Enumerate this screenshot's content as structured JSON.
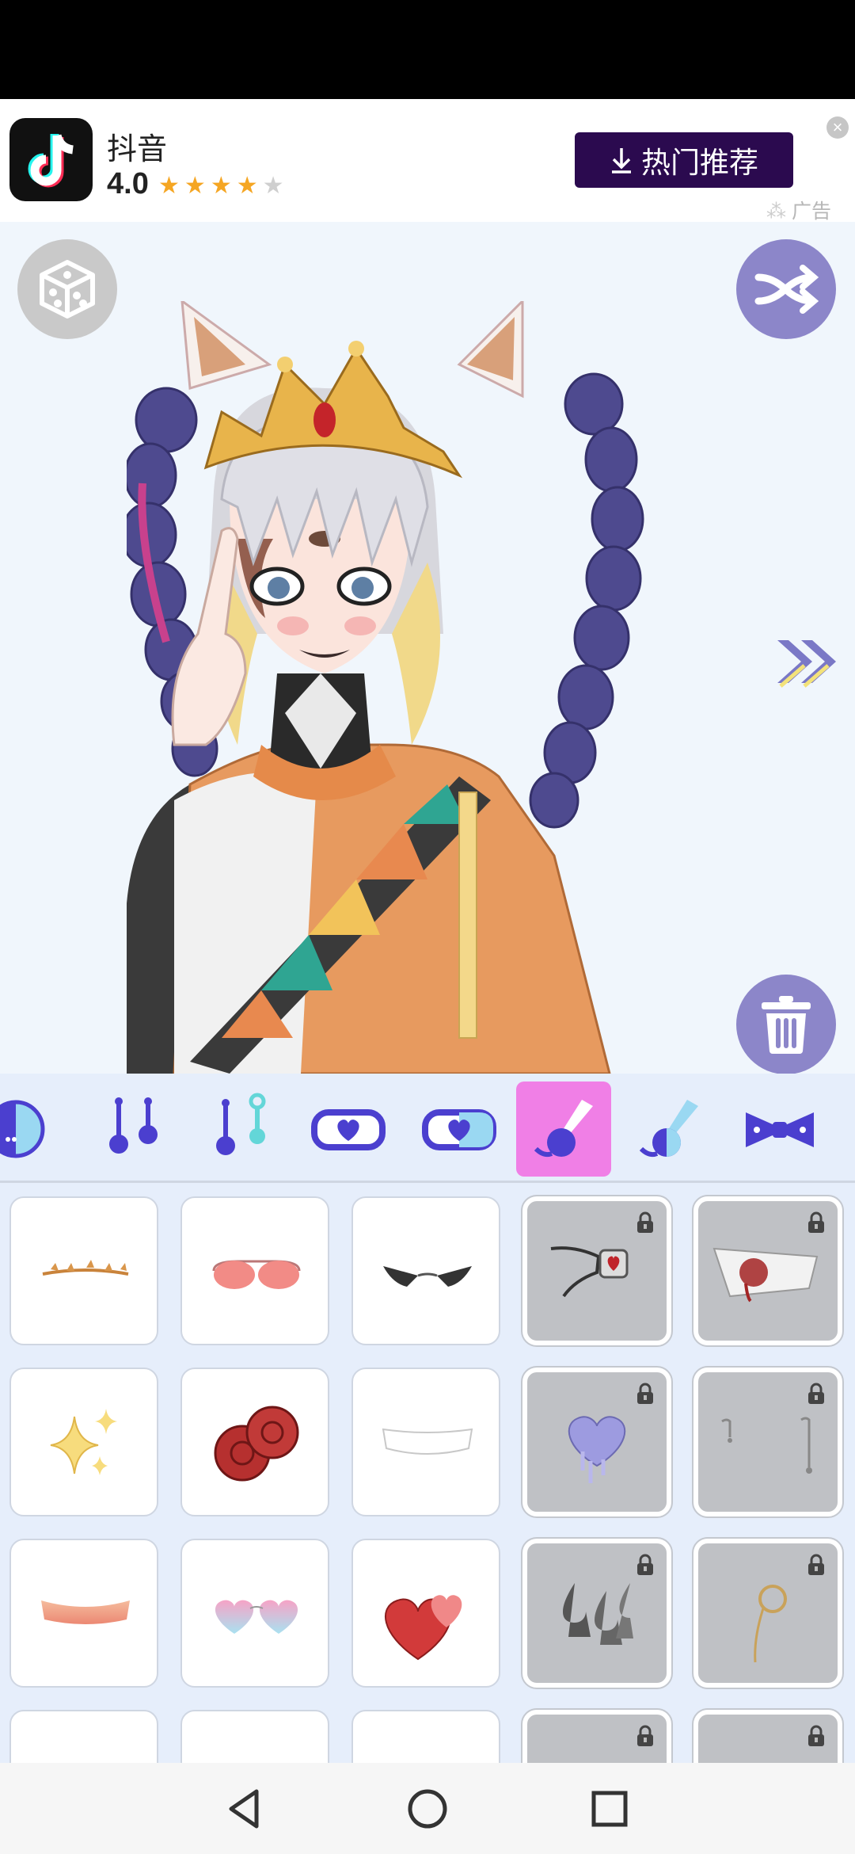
{
  "ad": {
    "app_name": "抖音",
    "rating": "4.0",
    "stars_filled": 4,
    "stars_total": 5,
    "button_label": "热门推荐",
    "ad_label": "广告",
    "close_icon": "close-icon",
    "download_icon": "download-icon"
  },
  "stage": {
    "dice_icon": "dice-icon",
    "shuffle_icon": "shuffle-icon",
    "trash_icon": "trash-icon",
    "next_icon": "double-chevron-right-icon"
  },
  "tabs": [
    {
      "icon": "skin-tone-icon",
      "active": false
    },
    {
      "icon": "earring-pair-icon",
      "active": false
    },
    {
      "icon": "earring-mixed-icon",
      "active": false
    },
    {
      "icon": "heart-mask-icon",
      "active": false
    },
    {
      "icon": "heart-mask-color-icon",
      "active": false
    },
    {
      "icon": "brush-icon",
      "active": true
    },
    {
      "icon": "brush-color-icon",
      "active": false
    },
    {
      "icon": "bow-icon",
      "active": false
    }
  ],
  "items": [
    {
      "name": "leaf-crown",
      "locked": false
    },
    {
      "name": "pink-sunglasses",
      "locked": false
    },
    {
      "name": "black-cat-eye-glasses",
      "locked": false
    },
    {
      "name": "ruby-necklace",
      "locked": true
    },
    {
      "name": "bloody-bandage",
      "locked": true
    },
    {
      "name": "sparkles",
      "locked": false
    },
    {
      "name": "red-roses",
      "locked": false
    },
    {
      "name": "white-mask",
      "locked": false
    },
    {
      "name": "dripping-heart",
      "locked": true
    },
    {
      "name": "drip-earrings",
      "locked": true
    },
    {
      "name": "blush",
      "locked": false
    },
    {
      "name": "heart-glasses",
      "locked": false
    },
    {
      "name": "red-hearts",
      "locked": false
    },
    {
      "name": "spades",
      "locked": true
    },
    {
      "name": "monocle",
      "locked": true
    },
    {
      "name": "item-16",
      "locked": false
    },
    {
      "name": "item-17",
      "locked": false
    },
    {
      "name": "item-18",
      "locked": false
    },
    {
      "name": "item-19",
      "locked": true
    },
    {
      "name": "item-20",
      "locked": true
    }
  ],
  "navbar": {
    "back_icon": "back-triangle-icon",
    "home_icon": "home-circle-icon",
    "recents_icon": "recents-square-icon"
  }
}
